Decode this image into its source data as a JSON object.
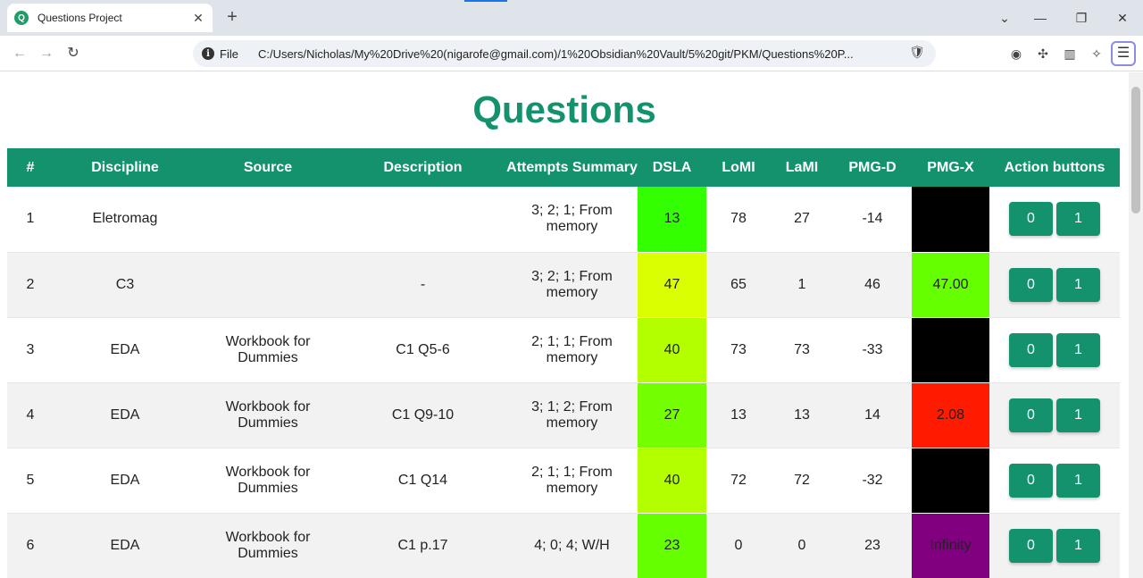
{
  "browser": {
    "tab_title": "Questions Project",
    "tab_favicon": "Q",
    "file_label": "File",
    "url": "C:/Users/Nicholas/My%20Drive%20(nigarofe@gmail.com)/1%20Obsidian%20Vault/5%20git/PKM/Questions%20P..."
  },
  "page": {
    "title": "Questions"
  },
  "table": {
    "headers": [
      "#",
      "Discipline",
      "Source",
      "Description",
      "Attempts Summary",
      "DSLA",
      "LoMI",
      "LaMI",
      "PMG-D",
      "PMG-X",
      "Action buttons"
    ],
    "rows": [
      {
        "num": "1",
        "discipline": "Eletromag",
        "source": "",
        "description": "",
        "attempts": "3; 2; 1; From memory",
        "dsla": "13",
        "dsla_color": "#33ff00",
        "lomi": "78",
        "lami": "27",
        "pmgd": "-14",
        "pmgx": "",
        "pmgx_color": "#000000",
        "btn0": "0",
        "btn1": "1"
      },
      {
        "num": "2",
        "discipline": "C3",
        "source": "",
        "description": "-",
        "attempts": "3; 2; 1; From memory",
        "dsla": "47",
        "dsla_color": "#d9ff00",
        "lomi": "65",
        "lami": "1",
        "pmgd": "46",
        "pmgx": "47.00",
        "pmgx_color": "#66ff00",
        "btn0": "0",
        "btn1": "1"
      },
      {
        "num": "3",
        "discipline": "EDA",
        "source": "Workbook for Dummies",
        "description": "C1 Q5-6",
        "attempts": "2; 1; 1; From memory",
        "dsla": "40",
        "dsla_color": "#b3ff00",
        "lomi": "73",
        "lami": "73",
        "pmgd": "-33",
        "pmgx": "",
        "pmgx_color": "#000000",
        "btn0": "0",
        "btn1": "1"
      },
      {
        "num": "4",
        "discipline": "EDA",
        "source": "Workbook for Dummies",
        "description": "C1 Q9-10",
        "attempts": "3; 1; 2; From memory",
        "dsla": "27",
        "dsla_color": "#73ff00",
        "lomi": "13",
        "lami": "13",
        "pmgd": "14",
        "pmgx": "2.08",
        "pmgx_color": "#ff1a00",
        "btn0": "0",
        "btn1": "1"
      },
      {
        "num": "5",
        "discipline": "EDA",
        "source": "Workbook for Dummies",
        "description": "C1 Q14",
        "attempts": "2; 1; 1; From memory",
        "dsla": "40",
        "dsla_color": "#b3ff00",
        "lomi": "72",
        "lami": "72",
        "pmgd": "-32",
        "pmgx": "",
        "pmgx_color": "#000000",
        "btn0": "0",
        "btn1": "1"
      },
      {
        "num": "6",
        "discipline": "EDA",
        "source": "Workbook for Dummies",
        "description": "C1 p.17",
        "attempts": "4; 0; 4; W/H",
        "dsla": "23",
        "dsla_color": "#66ff00",
        "lomi": "0",
        "lami": "0",
        "pmgd": "23",
        "pmgx": "Infinity",
        "pmgx_color": "#800080",
        "btn0": "0",
        "btn1": "1"
      }
    ]
  }
}
